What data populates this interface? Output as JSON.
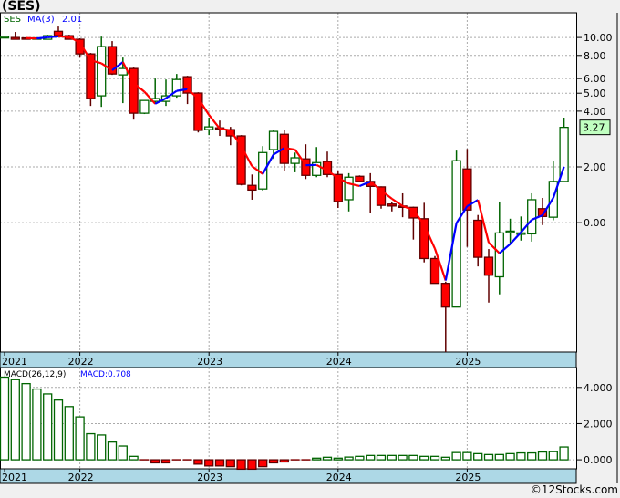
{
  "title": "(SES)",
  "footer": "©12Stocks.com",
  "colors": {
    "up": "#006400",
    "down": "#ff0000",
    "down_edge": "#600000",
    "ma_up": "#0000ff",
    "ma_down": "#ff0000",
    "date_band": "#add8e6",
    "price_tag": "#c0ffc0"
  },
  "chart_data": [
    {
      "type": "candlestick",
      "scale": "log",
      "legend": {
        "symbol": "SES",
        "ma_label": "MA(3)",
        "ma_value": "2.01"
      },
      "grid": true,
      "x_labels": [
        "2021",
        "2022",
        "2023",
        "2024",
        "2025"
      ],
      "x_label_index": [
        0,
        7,
        19,
        31,
        43
      ],
      "y_ticks": [
        {
          "value": 10,
          "label": "10.00"
        },
        {
          "value": 8,
          "label": "8.00"
        },
        {
          "value": 6,
          "label": "6.00"
        },
        {
          "value": 5,
          "label": "5.00"
        },
        {
          "value": 4,
          "label": "4.00"
        },
        {
          "value": 2,
          "label": "2.00"
        },
        {
          "value": 1,
          "label": "0.00"
        }
      ],
      "last_price": {
        "value": 3.27,
        "label": "3.27"
      },
      "ylim": [
        0.2,
        13.6
      ],
      "ma_period": 3,
      "candles_ohlc": [
        [
          10.0,
          10.23,
          9.95,
          10.11
        ],
        [
          10.0,
          10.71,
          9.78,
          9.78
        ],
        [
          9.95,
          10.0,
          9.89,
          9.89
        ],
        [
          9.89,
          10.0,
          9.85,
          9.95
        ],
        [
          9.78,
          10.34,
          9.78,
          10.23
        ],
        [
          10.8,
          11.46,
          10.23,
          10.23
        ],
        [
          10.23,
          10.34,
          9.78,
          9.78
        ],
        [
          9.78,
          9.89,
          7.79,
          8.15
        ],
        [
          8.15,
          8.25,
          4.27,
          4.68
        ],
        [
          4.84,
          10.11,
          4.22,
          8.93
        ],
        [
          8.93,
          9.56,
          6.28,
          6.35
        ],
        [
          6.28,
          7.79,
          4.42,
          6.8
        ],
        [
          6.8,
          6.88,
          3.6,
          3.9
        ],
        [
          3.9,
          4.57,
          3.86,
          4.57
        ],
        [
          4.52,
          6.0,
          4.37,
          4.68
        ],
        [
          4.52,
          5.93,
          4.27,
          4.84
        ],
        [
          4.84,
          6.35,
          4.73,
          5.93
        ],
        [
          6.14,
          6.21,
          4.37,
          5.01
        ],
        [
          5.01,
          5.06,
          3.07,
          3.15
        ],
        [
          3.18,
          3.69,
          2.97,
          3.29
        ],
        [
          3.25,
          3.56,
          2.94,
          3.22
        ],
        [
          3.18,
          3.29,
          2.62,
          2.94
        ],
        [
          2.94,
          2.97,
          1.59,
          1.61
        ],
        [
          1.59,
          1.82,
          1.33,
          1.5
        ],
        [
          1.52,
          2.59,
          1.49,
          2.39
        ],
        [
          2.48,
          3.18,
          2.21,
          3.11
        ],
        [
          3.0,
          3.15,
          1.91,
          2.09
        ],
        [
          2.09,
          2.39,
          1.87,
          2.24
        ],
        [
          2.21,
          2.65,
          1.72,
          1.8
        ],
        [
          1.8,
          2.56,
          1.76,
          2.11
        ],
        [
          2.14,
          2.42,
          1.76,
          1.82
        ],
        [
          1.82,
          1.89,
          1.2,
          1.3
        ],
        [
          1.33,
          1.85,
          1.15,
          1.76
        ],
        [
          1.78,
          1.8,
          1.65,
          1.67
        ],
        [
          1.67,
          1.85,
          1.13,
          1.57
        ],
        [
          1.56,
          1.57,
          1.19,
          1.24
        ],
        [
          1.26,
          1.3,
          1.15,
          1.23
        ],
        [
          1.23,
          1.44,
          1.07,
          1.22
        ],
        [
          1.21,
          1.22,
          0.81,
          1.06
        ],
        [
          1.05,
          1.28,
          0.61,
          0.64
        ],
        [
          0.64,
          0.66,
          0.47,
          0.47
        ],
        [
          0.47,
          0.48,
          0.2,
          0.35
        ],
        [
          0.35,
          2.45,
          0.35,
          2.16
        ],
        [
          1.95,
          2.5,
          0.74,
          1.17
        ],
        [
          1.03,
          1.1,
          0.58,
          0.65
        ],
        [
          0.65,
          0.72,
          0.37,
          0.52
        ],
        [
          0.51,
          1.3,
          0.41,
          0.88
        ],
        [
          0.89,
          1.05,
          0.77,
          0.9
        ],
        [
          0.87,
          1.08,
          0.8,
          0.88
        ],
        [
          0.87,
          1.44,
          0.79,
          1.33
        ],
        [
          1.19,
          1.36,
          0.97,
          1.08
        ],
        [
          1.07,
          2.14,
          1.03,
          1.67
        ],
        [
          1.67,
          3.69,
          1.67,
          3.27
        ]
      ]
    },
    {
      "type": "bar",
      "legend": {
        "label": "MACD(26,12,9)",
        "value_label": "MACD:0.708"
      },
      "grid": true,
      "x_labels": [
        "2021",
        "2022",
        "2023",
        "2024",
        "2025"
      ],
      "x_label_index": [
        0,
        7,
        19,
        31,
        43
      ],
      "y_ticks": [
        {
          "value": 4,
          "label": "4.000"
        },
        {
          "value": 2,
          "label": "2.000"
        },
        {
          "value": 0,
          "label": "0.000"
        }
      ],
      "ylim": [
        -0.5,
        5.1
      ],
      "values": [
        4.57,
        4.43,
        4.21,
        3.91,
        3.64,
        3.3,
        2.94,
        2.37,
        1.44,
        1.37,
        0.98,
        0.76,
        0.19,
        -0.02,
        -0.17,
        -0.17,
        -0.02,
        -0.02,
        -0.24,
        -0.34,
        -0.34,
        -0.38,
        -0.52,
        -0.52,
        -0.38,
        -0.17,
        -0.12,
        -0.02,
        -0.02,
        0.09,
        0.14,
        0.09,
        0.15,
        0.19,
        0.24,
        0.24,
        0.24,
        0.24,
        0.24,
        0.19,
        0.19,
        0.14,
        0.4,
        0.4,
        0.34,
        0.29,
        0.29,
        0.34,
        0.38,
        0.38,
        0.43,
        0.45,
        0.708
      ]
    }
  ]
}
